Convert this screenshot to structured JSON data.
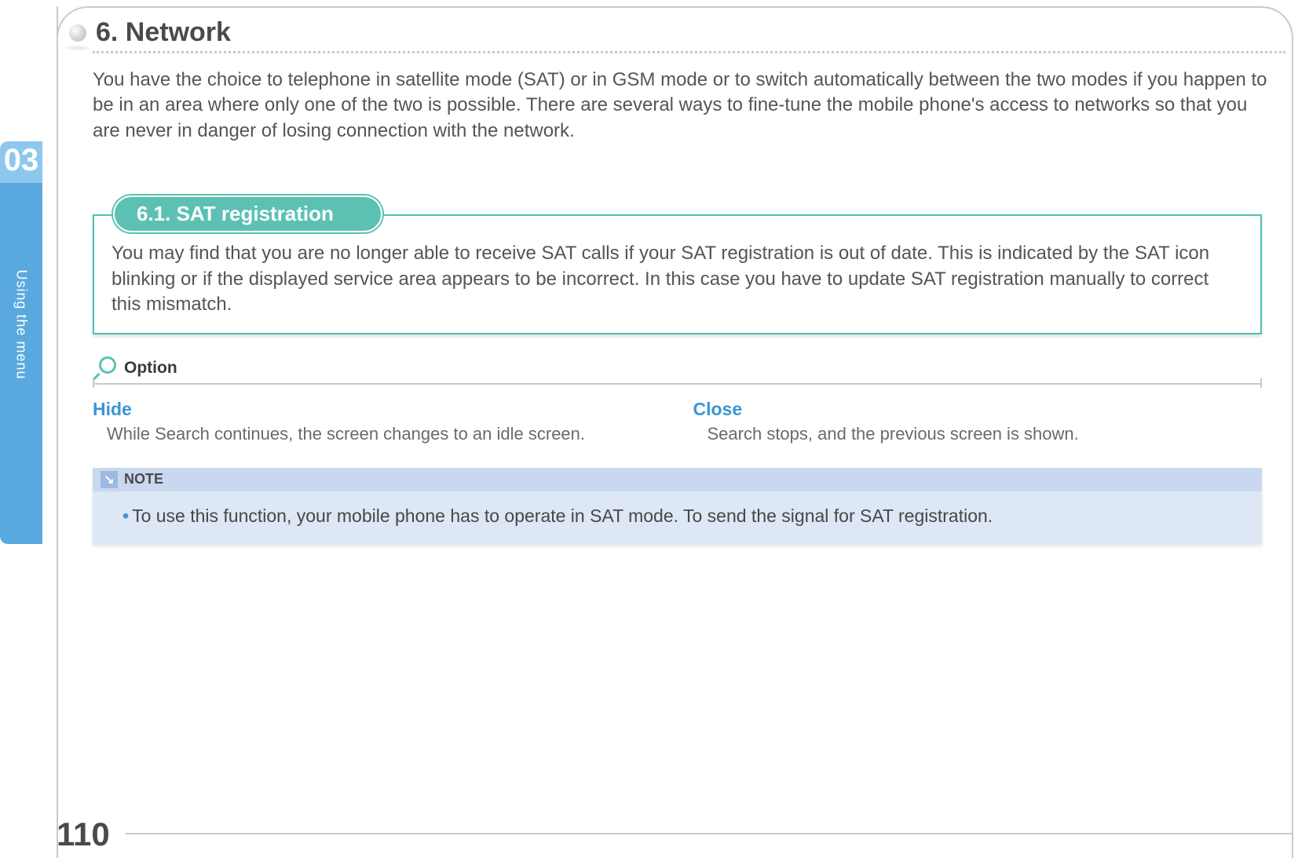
{
  "chapter": {
    "number": "03",
    "label": "Using the menu"
  },
  "heading": "6. Network",
  "intro": "You have the choice to telephone in satellite mode (SAT) or in GSM mode or to switch automatically between the two modes if you happen to be in an area where only one of the two is possible. There are several ways to fine-tune the mobile phone's access to networks so that you are never in danger of losing connection with the network.",
  "section": {
    "title": "6.1. SAT registration",
    "body": "You may find that you are no longer able to receive SAT calls if your SAT registration is out of date. This is indicated by the SAT icon blinking or if the displayed service area appears to be incorrect. In this case you have to update SAT registration manually to correct this mismatch."
  },
  "option": {
    "label": "Option",
    "items": [
      {
        "name": "Hide",
        "desc": "While Search continues, the screen changes to an idle screen."
      },
      {
        "name": "Close",
        "desc": "Search stops, and the previous screen is shown."
      }
    ]
  },
  "note": {
    "label": "NOTE",
    "body": "To use this function, your mobile phone has to operate in SAT mode. To send the signal for SAT registration."
  },
  "page_number": "110"
}
